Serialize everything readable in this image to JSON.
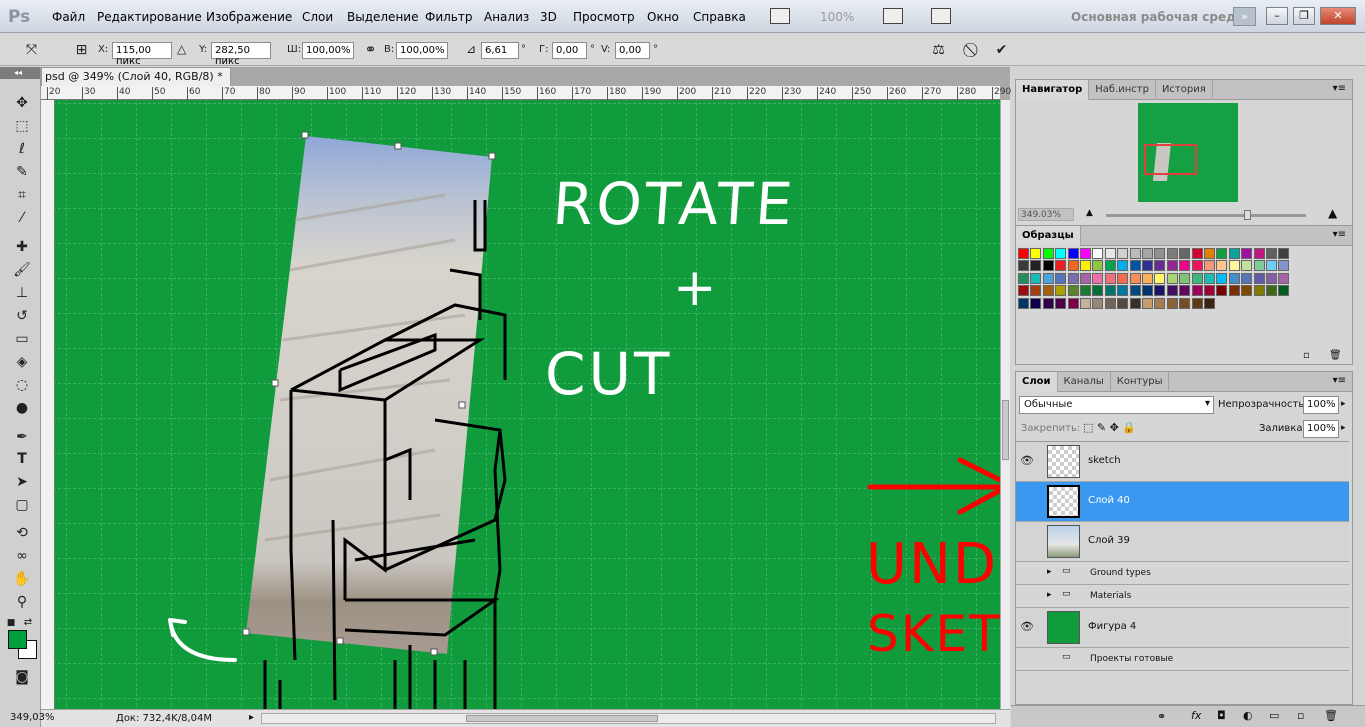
{
  "menu": {
    "logo": "Ps",
    "items": [
      "Файл",
      "Редактирование",
      "Изображение",
      "Слои",
      "Выделение",
      "Фильтр",
      "Анализ",
      "3D",
      "Просмотр",
      "Окно",
      "Справка"
    ],
    "zoom": "100%",
    "workspace": "Основная рабочая среда"
  },
  "options": {
    "x_label": "X:",
    "x_value": "115,00 пикс",
    "y_label": "Y:",
    "y_value": "282,50 пикс",
    "w_label": "Ш:",
    "w_value": "100,00%",
    "h_label": "В:",
    "h_value": "100,00%",
    "angle_value": "6,61",
    "deg": "°",
    "h_skew_label": "Г:",
    "h_skew_value": "0,00",
    "v_skew_label": "V:",
    "v_skew_value": "0,00"
  },
  "document": {
    "tab_title": "psd @ 349% (Слой 40, RGB/8) *",
    "ruler_ticks": [
      "20",
      "30",
      "40",
      "50",
      "60",
      "70",
      "80",
      "90",
      "100",
      "110",
      "120",
      "130",
      "140",
      "150",
      "160",
      "170",
      "180",
      "190",
      "200",
      "210",
      "220",
      "230",
      "240",
      "250",
      "260",
      "270",
      "280",
      "290"
    ],
    "status_zoom": "349,03%",
    "status_doc": "Док: 732,4K/8,04M",
    "annotation_rotate": "ROTATE",
    "annotation_plus": "+",
    "annotation_cut": "CUT",
    "annotation_under": "UNDER",
    "annotation_sketch": "SKETCH"
  },
  "navigator": {
    "tabs": [
      "Навигатор",
      "Наб.инстр",
      "История"
    ],
    "zoom": "349.03%"
  },
  "swatches": {
    "tab": "Образцы",
    "colors": [
      "#ff0000",
      "#ffff00",
      "#00ff00",
      "#00ffff",
      "#0000ff",
      "#ff00ff",
      "#ffffff",
      "#e6e6e6",
      "#d0d0d0",
      "#bbbbbb",
      "#a6a6a6",
      "#919191",
      "#7c7c7c",
      "#676767",
      "#d00030",
      "#e08000",
      "#10a040",
      "#10a0a0",
      "#a010a0",
      "#c01880",
      "#606060",
      "#404040",
      "#3a3a3a",
      "#222222",
      "#000000",
      "#ee1d24",
      "#f26522",
      "#fff200",
      "#8dc63f",
      "#00a651",
      "#00aeef",
      "#0054a6",
      "#2e3192",
      "#662d91",
      "#92278f",
      "#ec008c",
      "#ed145b",
      "#f7977a",
      "#fdc68a",
      "#fff799",
      "#c4df9b",
      "#82ca9c",
      "#6dcff6",
      "#8393ca",
      "#218f5f",
      "#1cbbb4",
      "#4aa3df",
      "#5674b9",
      "#7b6fb1",
      "#a864a8",
      "#f06eaa",
      "#f26d7d",
      "#f26c4f",
      "#f68e56",
      "#fbaf5d",
      "#fff568",
      "#acd373",
      "#7cc576",
      "#3cb878",
      "#1cbbb4",
      "#00bff3",
      "#448ccb",
      "#5574b9",
      "#605ca8",
      "#855fa8",
      "#a763a8",
      "#9e0b0f",
      "#a0410d",
      "#a36209",
      "#aba000",
      "#598527",
      "#1a7b30",
      "#007236",
      "#00746b",
      "#0076a3",
      "#004a80",
      "#003471",
      "#1b1464",
      "#440e62",
      "#630460",
      "#9e005d",
      "#9e0039",
      "#790000",
      "#7b2e00",
      "#7d4900",
      "#827b00",
      "#406618",
      "#005e20",
      "#003663",
      "#0d004c",
      "#32004b",
      "#4b0049",
      "#7b0046",
      "#c7b299",
      "#998675",
      "#736357",
      "#534741",
      "#37302a",
      "#c69c6d",
      "#a67c52",
      "#8c6239",
      "#754c24",
      "#603913",
      "#3c2415"
    ]
  },
  "layers": {
    "tabs": [
      "Слои",
      "Каналы",
      "Контуры"
    ],
    "blend_mode": "Обычные",
    "opacity_label": "Непрозрачность:",
    "opacity": "100%",
    "lock_label": "Закрепить:",
    "fill_label": "Заливка:",
    "fill": "100%",
    "items": [
      {
        "name": "sketch",
        "kind": "layer"
      },
      {
        "name": "Слой 40",
        "kind": "layer"
      },
      {
        "name": "Слой 39",
        "kind": "layer"
      },
      {
        "name": "Ground types",
        "kind": "group"
      },
      {
        "name": "Materials",
        "kind": "group"
      },
      {
        "name": "Фигура 4",
        "kind": "layer"
      },
      {
        "name": "Проекты готовые",
        "kind": "group"
      }
    ]
  },
  "colors": {
    "canvas_green": "#109c3d",
    "selected_layer": "#3b98f0",
    "annotation_red": "#ff0000"
  }
}
